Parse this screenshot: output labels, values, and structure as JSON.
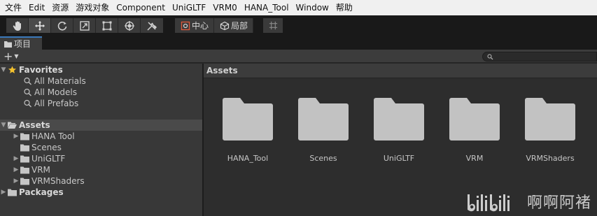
{
  "menubar": {
    "items": [
      "文件",
      "Edit",
      "资源",
      "游戏对象",
      "Component",
      "UniGLTF",
      "VRM0",
      "HANA_Tool",
      "Window",
      "帮助"
    ]
  },
  "toolbar": {
    "tools": [
      {
        "icon": "hand-icon",
        "active": false
      },
      {
        "icon": "move-icon",
        "active": true
      },
      {
        "icon": "rotate-icon",
        "active": false
      },
      {
        "icon": "scale-icon",
        "active": false
      },
      {
        "icon": "rect-tool-icon",
        "active": false
      },
      {
        "icon": "transform-tool-icon",
        "active": false
      },
      {
        "icon": "custom-tools-icon",
        "active": false
      }
    ],
    "pivot_label": "中心",
    "space_label": "局部"
  },
  "tab": {
    "label": "项目"
  },
  "panelbar": {
    "add_label": "+"
  },
  "tree": {
    "favorites": {
      "label": "Favorites",
      "items": [
        "All Materials",
        "All Models",
        "All Prefabs"
      ]
    },
    "assets": {
      "label": "Assets",
      "children": [
        {
          "label": "HANA Tool",
          "expandable": true
        },
        {
          "label": "Scenes",
          "expandable": false
        },
        {
          "label": "UniGLTF",
          "expandable": true
        },
        {
          "label": "VRM",
          "expandable": true
        },
        {
          "label": "VRMShaders",
          "expandable": true
        }
      ]
    },
    "packages": {
      "label": "Packages"
    }
  },
  "assets_panel": {
    "header": "Assets",
    "folders": [
      "HANA_Tool",
      "Scenes",
      "UniGLTF",
      "VRM",
      "VRMShaders"
    ]
  },
  "watermark": {
    "logo": "bilibili",
    "text": "啊啊阿褚"
  },
  "colors": {
    "accent": "#3a79bb",
    "folder": "#c2c2c2",
    "star": "#f2c12e"
  }
}
